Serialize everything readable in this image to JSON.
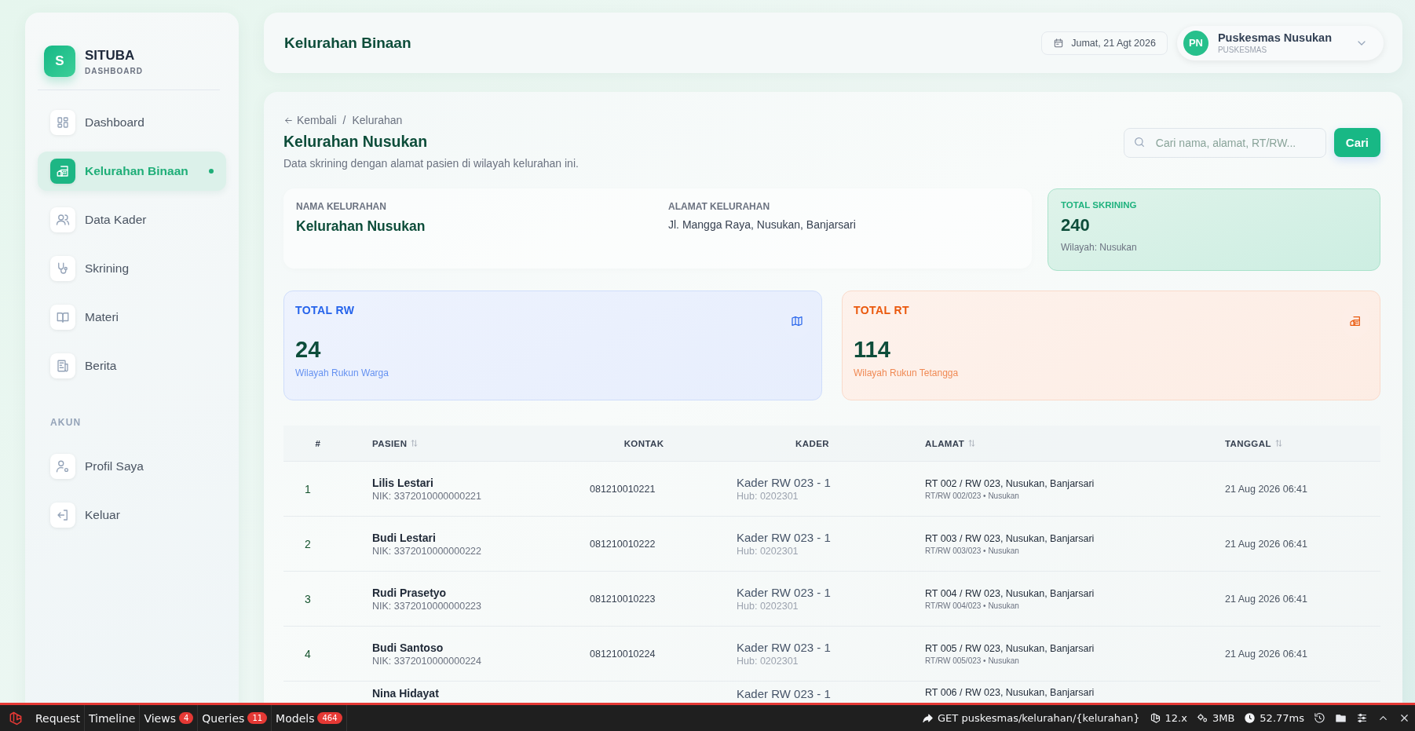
{
  "sidebar": {
    "logo_letter": "S",
    "brand": "SITUBA",
    "subtitle": "DASHBOARD",
    "items": [
      {
        "label": "Dashboard",
        "selected": false
      },
      {
        "label": "Kelurahan Binaan",
        "selected": true
      },
      {
        "label": "Data Kader",
        "selected": false
      },
      {
        "label": "Skrining",
        "selected": false
      },
      {
        "label": "Materi",
        "selected": false
      },
      {
        "label": "Berita",
        "selected": false
      }
    ],
    "section_label": "AKUN",
    "account_items": [
      {
        "label": "Profil Saya",
        "selected": false
      },
      {
        "label": "Keluar",
        "selected": false
      }
    ]
  },
  "header": {
    "title": "Kelurahan Binaan",
    "date": "Jumat, 21 Agt 2026",
    "user": {
      "initials": "PN",
      "name": "Puskesmas Nusukan",
      "role": "PUSKESMAS"
    }
  },
  "breadcrumb": {
    "back": "Kembali",
    "separator": "/",
    "current": "Kelurahan"
  },
  "page": {
    "title": "Kelurahan Nusukan",
    "subtitle": "Data skrining dengan alamat pasien di wilayah kelurahan ini."
  },
  "search": {
    "placeholder": "Cari nama, alamat, RT/RW...",
    "button": "Cari"
  },
  "info": [
    {
      "label": "NAMA KELURAHAN",
      "value": "Kelurahan Nusukan",
      "kind": "title"
    },
    {
      "label": "ALAMAT KELURAHAN",
      "value": "Jl. Mangga Raya, Nusukan, Banjarsari",
      "kind": "text"
    }
  ],
  "total_skrining": {
    "label": "TOTAL SKRINING",
    "value": "240",
    "note": "Wilayah: Nusukan"
  },
  "stats": [
    {
      "label": "TOTAL RW",
      "value": "24",
      "note": "Wilayah Rukun Warga",
      "color": "#2563eb"
    },
    {
      "label": "TOTAL RT",
      "value": "114",
      "note": "Wilayah Rukun Tetangga",
      "color": "#ea580c"
    }
  ],
  "table": {
    "columns": [
      {
        "label": "#",
        "sortable": false
      },
      {
        "label": "PASIEN",
        "sortable": true
      },
      {
        "label": "KONTAK",
        "sortable": false
      },
      {
        "label": "KADER",
        "sortable": false
      },
      {
        "label": "ALAMAT",
        "sortable": true
      },
      {
        "label": "TANGGAL",
        "sortable": true
      }
    ],
    "rows": [
      {
        "no": "1",
        "name": "Lilis Lestari",
        "nik": "NIK: 3372010000000221",
        "contact": "081210010221",
        "kader": "Kader RW 023 - 1",
        "hub": "Hub: 0202301",
        "address": "RT 002 / RW 023, Nusukan, Banjarsari",
        "address_detail": "RT/RW 002/023 • Nusukan",
        "date": "21 Aug 2026 06:41"
      },
      {
        "no": "2",
        "name": "Budi Lestari",
        "nik": "NIK: 3372010000000222",
        "contact": "081210010222",
        "kader": "Kader RW 023 - 1",
        "hub": "Hub: 0202301",
        "address": "RT 003 / RW 023, Nusukan, Banjarsari",
        "address_detail": "RT/RW 003/023 • Nusukan",
        "date": "21 Aug 2026 06:41"
      },
      {
        "no": "3",
        "name": "Rudi Prasetyo",
        "nik": "NIK: 3372010000000223",
        "contact": "081210010223",
        "kader": "Kader RW 023 - 1",
        "hub": "Hub: 0202301",
        "address": "RT 004 / RW 023, Nusukan, Banjarsari",
        "address_detail": "RT/RW 004/023 • Nusukan",
        "date": "21 Aug 2026 06:41"
      },
      {
        "no": "4",
        "name": "Budi Santoso",
        "nik": "NIK: 3372010000000224",
        "contact": "081210010224",
        "kader": "Kader RW 023 - 1",
        "hub": "Hub: 0202301",
        "address": "RT 005 / RW 023, Nusukan, Banjarsari",
        "address_detail": "RT/RW 005/023 • Nusukan",
        "date": "21 Aug 2026 06:41"
      },
      {
        "name": "Nina Hidayat",
        "kader": "Kader RW 023 - 1",
        "address": "RT 006 / RW 023, Nusukan, Banjarsari"
      }
    ]
  },
  "debugbar": {
    "tabs": [
      {
        "label": "Request"
      },
      {
        "label": "Timeline"
      },
      {
        "label": "Views",
        "count": "4"
      },
      {
        "label": "Queries",
        "count": "11"
      },
      {
        "label": "Models",
        "count": "464"
      }
    ],
    "info": [
      {
        "label": "GET puskesmas/kelurahan/{kelurahan}"
      },
      {
        "label": "12.x"
      },
      {
        "label": "3MB"
      },
      {
        "label": "52.77ms"
      }
    ]
  }
}
